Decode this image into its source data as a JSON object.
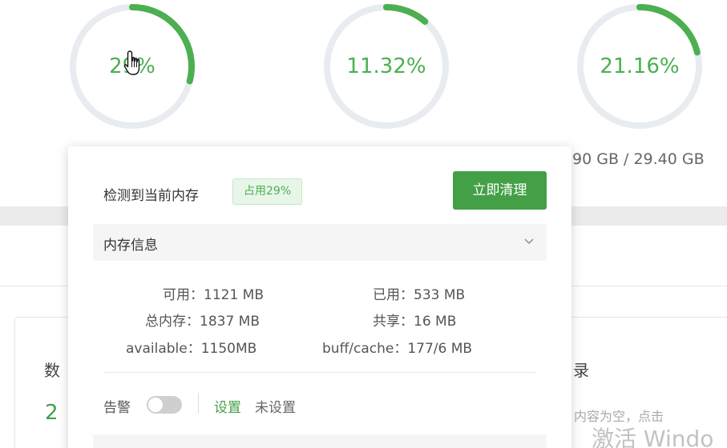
{
  "gauges": [
    {
      "value_text": "29%",
      "fraction": 0.29
    },
    {
      "value_text": "11.32%",
      "fraction": 0.1132
    },
    {
      "value_text": "21.16%",
      "fraction": 0.2116
    }
  ],
  "disk_text": "90 GB / 29.40 GB",
  "card": {
    "left_title": "数",
    "left_number": "2",
    "right_title": "录",
    "right_empty_text": "内容为空，点击",
    "watermark": "激活 Windo"
  },
  "colors": {
    "accent": "#43a047",
    "gauge_track": "#e8ecf1",
    "gauge_arc": "#4caf50"
  },
  "popover": {
    "detect_label": "检测到当前内存",
    "usage_badge": "占用29%",
    "clean_button": "立即清理",
    "info_title": "内存信息",
    "stats_left": [
      {
        "key": "可用：",
        "value": "1121 MB"
      },
      {
        "key": "总内存：",
        "value": "1837 MB"
      },
      {
        "key": "available：",
        "value": "1150MB"
      }
    ],
    "stats_right": [
      {
        "key": "已用：",
        "value": "533 MB"
      },
      {
        "key": "共享：",
        "value": "16 MB"
      },
      {
        "key": "buff/cache：",
        "value": "177/6 MB"
      }
    ],
    "alarm_label": "告警",
    "alarm_toggle_on": false,
    "settings_link": "设置",
    "alarm_status": "未设置"
  },
  "icons": {
    "cursor": "hand-pointer-icon",
    "chevron": "chevron-down-icon"
  }
}
